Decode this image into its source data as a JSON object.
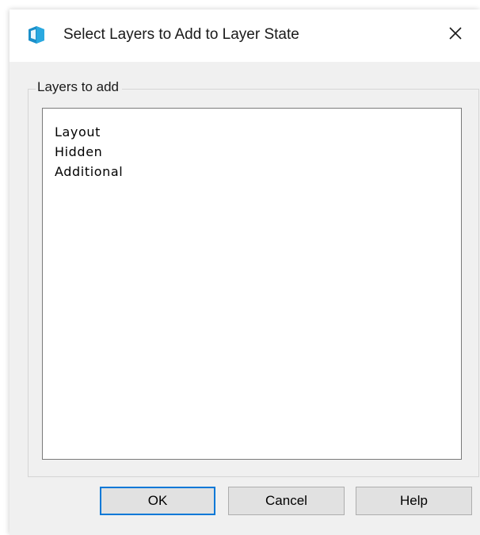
{
  "dialog": {
    "title": "Select Layers to Add to Layer State",
    "icon": "autocad-app-icon",
    "close_icon": "close-icon"
  },
  "group": {
    "label": "Layers to add"
  },
  "layers": [
    {
      "label": "Layout"
    },
    {
      "label": "Hidden"
    },
    {
      "label": "Additional"
    }
  ],
  "buttons": {
    "ok": "OK",
    "cancel": "Cancel",
    "help": "Help"
  },
  "colors": {
    "icon_accent": "#2aa9e0",
    "default_button_border": "#0078d7"
  }
}
